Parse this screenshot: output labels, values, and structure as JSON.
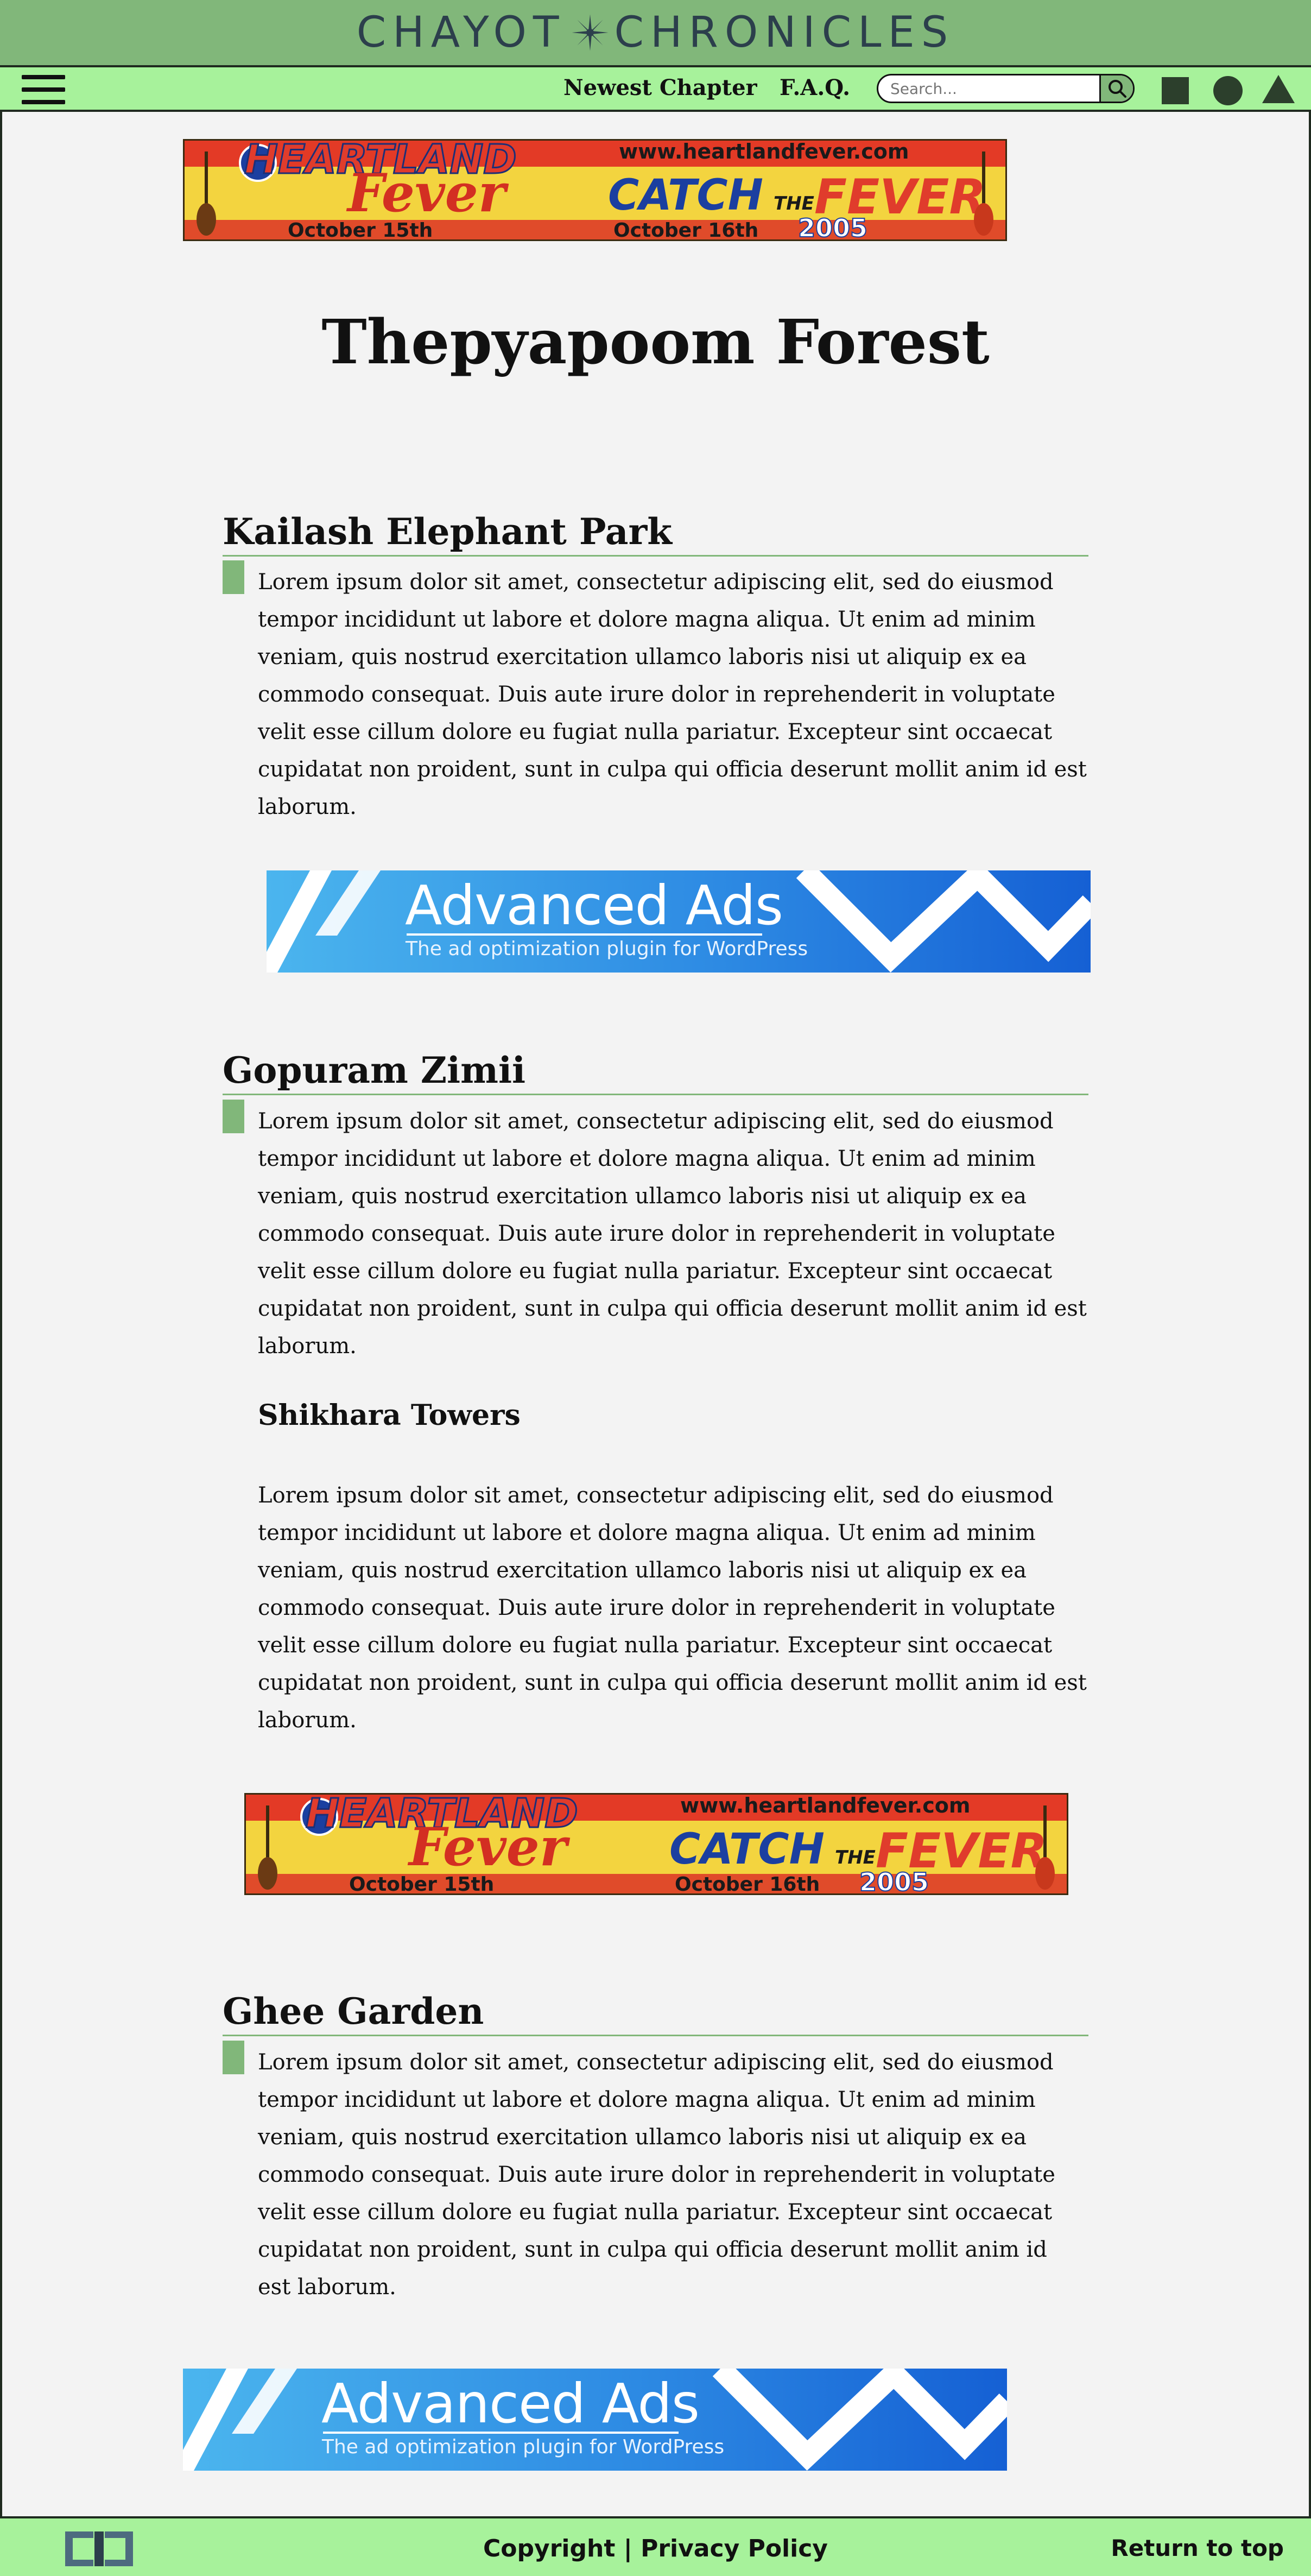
{
  "header": {
    "brand_left": "CHAYOT",
    "brand_right": "CHRONICLES",
    "brand_icon": "star-icon"
  },
  "nav": {
    "menu_icon": "hamburger-menu-icon",
    "links": [
      "Newest Chapter",
      "F.A.Q."
    ],
    "search_placeholder": "Search...",
    "search_icon": "search-icon",
    "shape_icons": [
      "square-icon",
      "circle-icon",
      "triangle-icon"
    ]
  },
  "ads": {
    "heartland": {
      "title": "HEARTLAND",
      "fever": "Fever",
      "url": "www.heartlandfever.com",
      "catch": "CATCH",
      "the": "THE",
      "fever2": "FEVER",
      "date1": "October 15th",
      "date2": "October 16th",
      "year": "2005"
    },
    "advanced": {
      "title": "Advanced Ads",
      "subtitle": "The ad optimization plugin for WordPress"
    }
  },
  "main": {
    "title": "Thepyapoom Forest",
    "sections": [
      {
        "heading": "Kailash Elephant Park",
        "text": "Lorem ipsum dolor sit amet, consectetur adipiscing elit, sed do eiusmod tempor incididunt ut labore et dolore magna aliqua. Ut enim ad minim veniam, quis nostrud exercitation ullamco laboris nisi ut aliquip ex ea commodo consequat. Duis aute irure dolor in reprehenderit in voluptate velit esse cillum dolore eu fugiat nulla pariatur. Excepteur sint occaecat cupidatat non proident, sunt in culpa qui officia deserunt mollit anim id est laborum."
      },
      {
        "heading": "Gopuram Zimii",
        "text": "Lorem ipsum dolor sit amet, consectetur adipiscing elit, sed do eiusmod tempor incididunt ut labore et dolore magna aliqua. Ut enim ad minim veniam, quis nostrud exercitation ullamco laboris nisi ut aliquip ex ea commodo consequat. Duis aute irure dolor in reprehenderit in voluptate velit esse cillum dolore eu fugiat nulla pariatur. Excepteur sint occaecat cupidatat non proident, sunt in culpa qui officia deserunt mollit anim id est laborum.",
        "subsection": {
          "heading": "Shikhara Towers",
          "text": "Lorem ipsum dolor sit amet, consectetur adipiscing elit, sed do eiusmod tempor incididunt ut labore et dolore magna aliqua. Ut enim ad minim veniam, quis nostrud exercitation ullamco laboris nisi ut aliquip ex ea commodo consequat. Duis aute irure dolor in reprehenderit in voluptate velit esse cillum dolore eu fugiat nulla pariatur. Excepteur sint occaecat cupidatat non proident, sunt in culpa qui officia deserunt mollit anim id est laborum."
        }
      },
      {
        "heading": "Ghee Garden",
        "text": "Lorem ipsum dolor sit amet, consectetur adipiscing elit, sed do eiusmod tempor incididunt ut labore et dolore magna aliqua. Ut enim ad minim veniam, quis nostrud exercitation ullamco laboris nisi ut aliquip ex ea commodo consequat. Duis aute irure dolor in reprehenderit in voluptate velit esse cillum dolore eu fugiat nulla pariatur. Excepteur sint occaecat cupidatat non proident, sunt in culpa qui officia deserunt mollit anim id est laborum."
      }
    ]
  },
  "footer": {
    "logo_icon": "cc-logo-icon",
    "copyright": "Copyright",
    "separator": "|",
    "privacy": "Privacy Policy",
    "return_top": "Return to top"
  },
  "colors": {
    "header_green": "#81b77a",
    "nav_green": "#a7f29b",
    "accent_green": "#81b77a",
    "page_bg": "#f3f3f3",
    "brand_text": "#2c3f4c"
  }
}
